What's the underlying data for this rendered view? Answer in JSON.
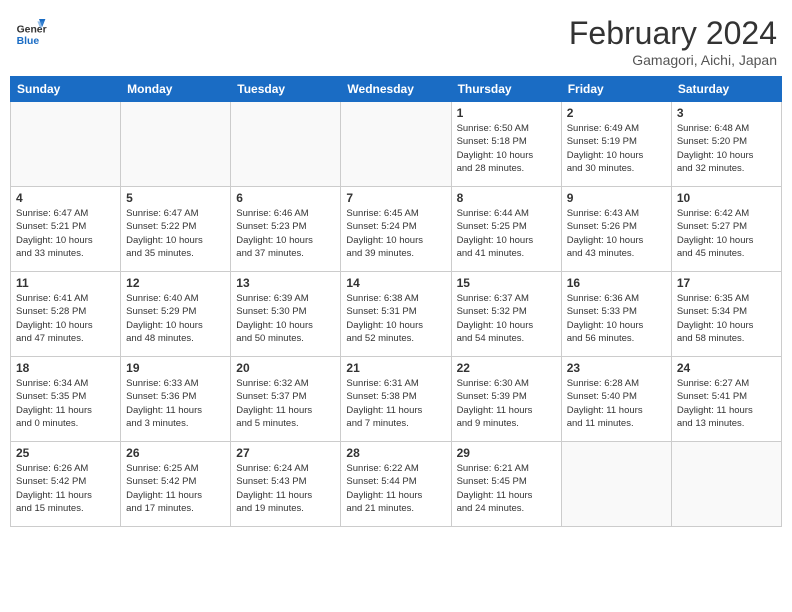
{
  "header": {
    "logo_line1": "General",
    "logo_line2": "Blue",
    "month_year": "February 2024",
    "location": "Gamagori, Aichi, Japan"
  },
  "weekdays": [
    "Sunday",
    "Monday",
    "Tuesday",
    "Wednesday",
    "Thursday",
    "Friday",
    "Saturday"
  ],
  "weeks": [
    [
      {
        "day": "",
        "info": ""
      },
      {
        "day": "",
        "info": ""
      },
      {
        "day": "",
        "info": ""
      },
      {
        "day": "",
        "info": ""
      },
      {
        "day": "1",
        "info": "Sunrise: 6:50 AM\nSunset: 5:18 PM\nDaylight: 10 hours\nand 28 minutes."
      },
      {
        "day": "2",
        "info": "Sunrise: 6:49 AM\nSunset: 5:19 PM\nDaylight: 10 hours\nand 30 minutes."
      },
      {
        "day": "3",
        "info": "Sunrise: 6:48 AM\nSunset: 5:20 PM\nDaylight: 10 hours\nand 32 minutes."
      }
    ],
    [
      {
        "day": "4",
        "info": "Sunrise: 6:47 AM\nSunset: 5:21 PM\nDaylight: 10 hours\nand 33 minutes."
      },
      {
        "day": "5",
        "info": "Sunrise: 6:47 AM\nSunset: 5:22 PM\nDaylight: 10 hours\nand 35 minutes."
      },
      {
        "day": "6",
        "info": "Sunrise: 6:46 AM\nSunset: 5:23 PM\nDaylight: 10 hours\nand 37 minutes."
      },
      {
        "day": "7",
        "info": "Sunrise: 6:45 AM\nSunset: 5:24 PM\nDaylight: 10 hours\nand 39 minutes."
      },
      {
        "day": "8",
        "info": "Sunrise: 6:44 AM\nSunset: 5:25 PM\nDaylight: 10 hours\nand 41 minutes."
      },
      {
        "day": "9",
        "info": "Sunrise: 6:43 AM\nSunset: 5:26 PM\nDaylight: 10 hours\nand 43 minutes."
      },
      {
        "day": "10",
        "info": "Sunrise: 6:42 AM\nSunset: 5:27 PM\nDaylight: 10 hours\nand 45 minutes."
      }
    ],
    [
      {
        "day": "11",
        "info": "Sunrise: 6:41 AM\nSunset: 5:28 PM\nDaylight: 10 hours\nand 47 minutes."
      },
      {
        "day": "12",
        "info": "Sunrise: 6:40 AM\nSunset: 5:29 PM\nDaylight: 10 hours\nand 48 minutes."
      },
      {
        "day": "13",
        "info": "Sunrise: 6:39 AM\nSunset: 5:30 PM\nDaylight: 10 hours\nand 50 minutes."
      },
      {
        "day": "14",
        "info": "Sunrise: 6:38 AM\nSunset: 5:31 PM\nDaylight: 10 hours\nand 52 minutes."
      },
      {
        "day": "15",
        "info": "Sunrise: 6:37 AM\nSunset: 5:32 PM\nDaylight: 10 hours\nand 54 minutes."
      },
      {
        "day": "16",
        "info": "Sunrise: 6:36 AM\nSunset: 5:33 PM\nDaylight: 10 hours\nand 56 minutes."
      },
      {
        "day": "17",
        "info": "Sunrise: 6:35 AM\nSunset: 5:34 PM\nDaylight: 10 hours\nand 58 minutes."
      }
    ],
    [
      {
        "day": "18",
        "info": "Sunrise: 6:34 AM\nSunset: 5:35 PM\nDaylight: 11 hours\nand 0 minutes."
      },
      {
        "day": "19",
        "info": "Sunrise: 6:33 AM\nSunset: 5:36 PM\nDaylight: 11 hours\nand 3 minutes."
      },
      {
        "day": "20",
        "info": "Sunrise: 6:32 AM\nSunset: 5:37 PM\nDaylight: 11 hours\nand 5 minutes."
      },
      {
        "day": "21",
        "info": "Sunrise: 6:31 AM\nSunset: 5:38 PM\nDaylight: 11 hours\nand 7 minutes."
      },
      {
        "day": "22",
        "info": "Sunrise: 6:30 AM\nSunset: 5:39 PM\nDaylight: 11 hours\nand 9 minutes."
      },
      {
        "day": "23",
        "info": "Sunrise: 6:28 AM\nSunset: 5:40 PM\nDaylight: 11 hours\nand 11 minutes."
      },
      {
        "day": "24",
        "info": "Sunrise: 6:27 AM\nSunset: 5:41 PM\nDaylight: 11 hours\nand 13 minutes."
      }
    ],
    [
      {
        "day": "25",
        "info": "Sunrise: 6:26 AM\nSunset: 5:42 PM\nDaylight: 11 hours\nand 15 minutes."
      },
      {
        "day": "26",
        "info": "Sunrise: 6:25 AM\nSunset: 5:42 PM\nDaylight: 11 hours\nand 17 minutes."
      },
      {
        "day": "27",
        "info": "Sunrise: 6:24 AM\nSunset: 5:43 PM\nDaylight: 11 hours\nand 19 minutes."
      },
      {
        "day": "28",
        "info": "Sunrise: 6:22 AM\nSunset: 5:44 PM\nDaylight: 11 hours\nand 21 minutes."
      },
      {
        "day": "29",
        "info": "Sunrise: 6:21 AM\nSunset: 5:45 PM\nDaylight: 11 hours\nand 24 minutes."
      },
      {
        "day": "",
        "info": ""
      },
      {
        "day": "",
        "info": ""
      }
    ]
  ]
}
